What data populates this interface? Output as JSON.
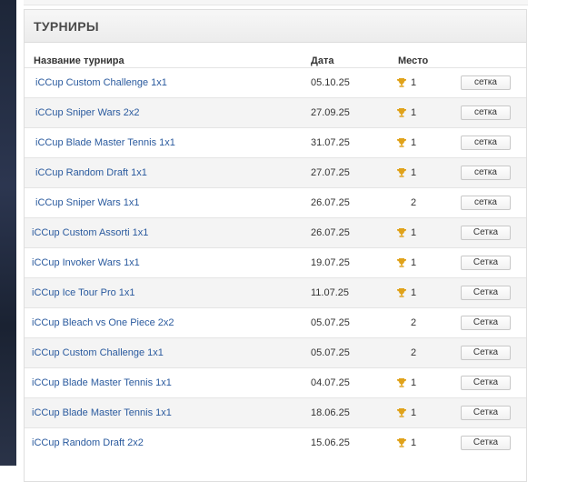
{
  "panel": {
    "title": "ТУРНИРЫ",
    "columns": {
      "name": "Название турнира",
      "date": "Дата",
      "place": "Место"
    }
  },
  "tournaments": [
    {
      "name": "iCCup Custom Challenge 1x1",
      "date": "05.10.25",
      "place": "1",
      "trophy": true,
      "button": "сетка"
    },
    {
      "name": "iCCup Sniper Wars 2x2",
      "date": "27.09.25",
      "place": "1",
      "trophy": true,
      "button": "сетка"
    },
    {
      "name": "iCCup Blade Master Tennis 1x1",
      "date": "31.07.25",
      "place": "1",
      "trophy": true,
      "button": "сетка"
    },
    {
      "name": "iCCup Random Draft 1x1",
      "date": "27.07.25",
      "place": "1",
      "trophy": true,
      "button": "сетка"
    },
    {
      "name": "iCCup Sniper Wars 1x1",
      "date": "26.07.25",
      "place": "2",
      "trophy": false,
      "button": "сетка"
    },
    {
      "name": "iCCup Custom Assorti 1x1",
      "date": "26.07.25",
      "place": "1",
      "trophy": true,
      "button": "Сетка"
    },
    {
      "name": "iCCup Invoker Wars 1x1",
      "date": "19.07.25",
      "place": "1",
      "trophy": true,
      "button": "Сетка"
    },
    {
      "name": "iCCup Ice Tour Pro 1x1",
      "date": "11.07.25",
      "place": "1",
      "trophy": true,
      "button": "Сетка"
    },
    {
      "name": "iCCup Bleach vs One Piece 2x2",
      "date": "05.07.25",
      "place": "2",
      "trophy": false,
      "button": "Сетка"
    },
    {
      "name": "iCCup Custom Challenge 1x1",
      "date": "05.07.25",
      "place": "2",
      "trophy": false,
      "button": "Сетка"
    },
    {
      "name": "iCCup Blade Master Tennis 1x1",
      "date": "04.07.25",
      "place": "1",
      "trophy": true,
      "button": "Сетка"
    },
    {
      "name": "iCCup Blade Master Tennis 1x1",
      "date": "18.06.25",
      "place": "1",
      "trophy": true,
      "button": "Сетка"
    },
    {
      "name": "iCCup Random Draft 2x2",
      "date": "15.06.25",
      "place": "1",
      "trophy": true,
      "button": "Сетка"
    }
  ],
  "icons": {
    "trophy": "trophy-icon"
  },
  "colors": {
    "link": "#2a5a9e",
    "trophy": "#e0a21a",
    "header_bg": "#ececec"
  }
}
